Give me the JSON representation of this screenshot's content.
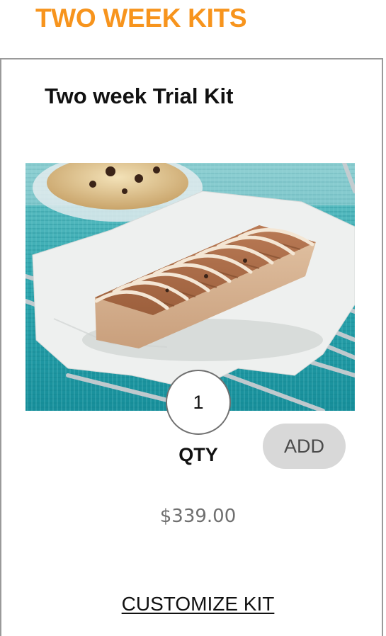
{
  "section": {
    "title": "TWO WEEK KITS"
  },
  "product": {
    "title": "Two week Trial Kit",
    "image_icon": "protein-bar-product-photo",
    "quantity": "1",
    "quantity_label": "QTY",
    "add_label": "ADD",
    "price": "$339.00",
    "customize_label": "CUSTOMIZE KIT"
  },
  "colors": {
    "accent": "#f7941d",
    "add_button_bg": "#d8d8d8",
    "card_border": "#9a9a9a",
    "price_text": "#6f6f6f"
  }
}
